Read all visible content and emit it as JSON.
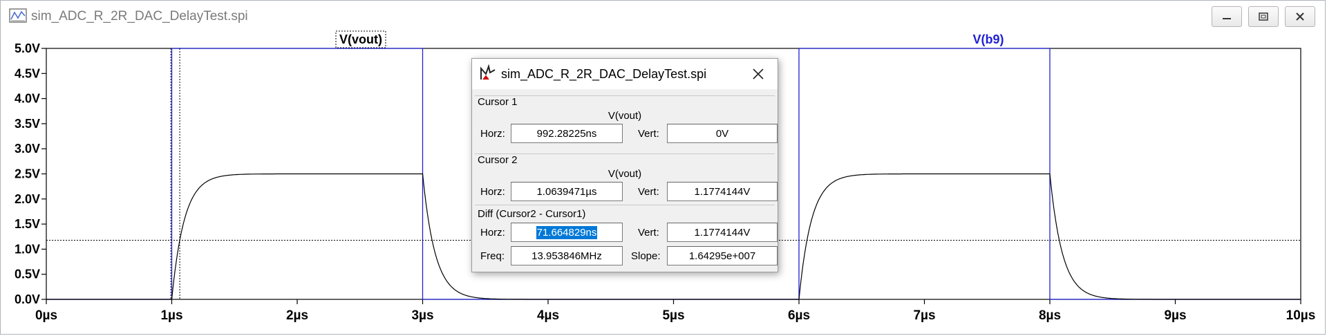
{
  "window": {
    "title": "sim_ADC_R_2R_DAC_DelayTest.spi",
    "minimize_glyph": "—",
    "maximize_glyph": "▢",
    "close_glyph": "✕"
  },
  "plot": {
    "traces": [
      {
        "name": "V(vout)",
        "color": "#000000"
      },
      {
        "name": "V(b9)",
        "color": "#1f1fd6"
      }
    ],
    "y_ticks": [
      "0.0V",
      "0.5V",
      "1.0V",
      "1.5V",
      "2.0V",
      "2.5V",
      "3.0V",
      "3.5V",
      "4.0V",
      "4.5V",
      "5.0V"
    ],
    "x_ticks": [
      "0µs",
      "1µs",
      "2µs",
      "3µs",
      "4µs",
      "5µs",
      "6µs",
      "7µs",
      "8µs",
      "9µs",
      "10µs"
    ],
    "y_range_v": [
      0,
      5
    ],
    "x_range_us": [
      0,
      10
    ],
    "grid": false
  },
  "chart_data": {
    "type": "line",
    "xlabel": "",
    "ylabel": "",
    "xlim": [
      0,
      10
    ],
    "ylim": [
      0,
      5
    ],
    "series": [
      {
        "name": "V(vout)",
        "note_shape": "rc_pulse",
        "low": 0.0,
        "high": 2.5,
        "pulses": [
          [
            1,
            3
          ],
          [
            6,
            8
          ]
        ],
        "tau_us": 0.1
      },
      {
        "name": "V(b9)",
        "pulses": [
          [
            1,
            3
          ],
          [
            6,
            8
          ]
        ],
        "low": 0.0,
        "high": 5.0
      }
    ],
    "cursors": {
      "cursor1_x_us": 0.99228225,
      "cursor2_x_us": 1.0639471,
      "cursor2_y_v": 1.1774144
    }
  },
  "dialog": {
    "title": "sim_ADC_R_2R_DAC_DelayTest.spi",
    "close_glyph": "✕",
    "cursor1": {
      "group_label": "Cursor 1",
      "trace": "V(vout)",
      "horz_label": "Horz:",
      "horz_value": "992.28225ns",
      "vert_label": "Vert:",
      "vert_value": "0V"
    },
    "cursor2": {
      "group_label": "Cursor 2",
      "trace": "V(vout)",
      "horz_label": "Horz:",
      "horz_value": "1.0639471µs",
      "vert_label": "Vert:",
      "vert_value": "1.1774144V"
    },
    "diff": {
      "group_label": "Diff (Cursor2 - Cursor1)",
      "horz_label": "Horz:",
      "horz_value": "71.664829ns",
      "vert_label": "Vert:",
      "vert_value": "1.1774144V",
      "freq_label": "Freq:",
      "freq_value": "13.953846MHz",
      "slope_label": "Slope:",
      "slope_value": "1.64295e+007"
    }
  }
}
